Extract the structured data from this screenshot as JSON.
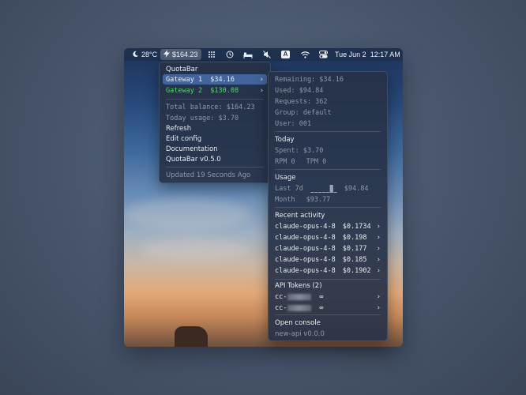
{
  "menubar": {
    "weather": "28°C",
    "balance": "$164.23",
    "date": "Tue Jun 2",
    "time": "12:17 AM",
    "input_letter": "A",
    "icons": [
      "moon-icon",
      "bolt-icon",
      "grid-icon",
      "history-icon",
      "bed-icon",
      "mute-icon",
      "input-source-icon",
      "wifi-icon",
      "control-center-icon"
    ]
  },
  "main_menu": {
    "title": "QuotaBar",
    "gateways": [
      {
        "label": "Gateway 1  $34.16"
      },
      {
        "label": "Gateway 2  $130.08"
      }
    ],
    "total_balance": "Total balance: $164.23",
    "today_usage": "Today usage: $3.70",
    "refresh": "Refresh",
    "edit_config": "Edit config",
    "documentation": "Documentation",
    "version": "QuotaBar v0.5.0",
    "updated": "Updated 19 Seconds Ago"
  },
  "submenu": {
    "remaining": "Remaining: $34.16",
    "used": "Used: $94.84",
    "requests": "Requests: 362",
    "group": "Group: default",
    "user": "User: 001",
    "today_header": "Today",
    "spent": "Spent: $3.70",
    "rpm": "RPM 0",
    "tpm": "TPM 0",
    "usage_header": "Usage",
    "last7d_label": "Last 7d",
    "last7d_value": "$94.84",
    "month_label": "Month",
    "month_value": "$93.77",
    "sparkline": [
      0.05,
      0.05,
      0.05,
      0.05,
      0.08,
      1.0,
      0.1
    ],
    "recent_header": "Recent activity",
    "activity": [
      {
        "model": "claude-opus-4-8",
        "cost": "$0.1734"
      },
      {
        "model": "claude-opus-4-8",
        "cost": "$0.198"
      },
      {
        "model": "claude-opus-4-8",
        "cost": "$0.177"
      },
      {
        "model": "claude-opus-4-8",
        "cost": "$0.185"
      },
      {
        "model": "claude-opus-4-8",
        "cost": "$0.1902"
      }
    ],
    "tokens_header": "API Tokens (2)",
    "tokens": [
      {
        "prefix": "cc-",
        "limit": "∞"
      },
      {
        "prefix": "cc-",
        "limit": "∞"
      }
    ],
    "open_console": "Open console",
    "api_version": "new-api v0.0.0"
  }
}
